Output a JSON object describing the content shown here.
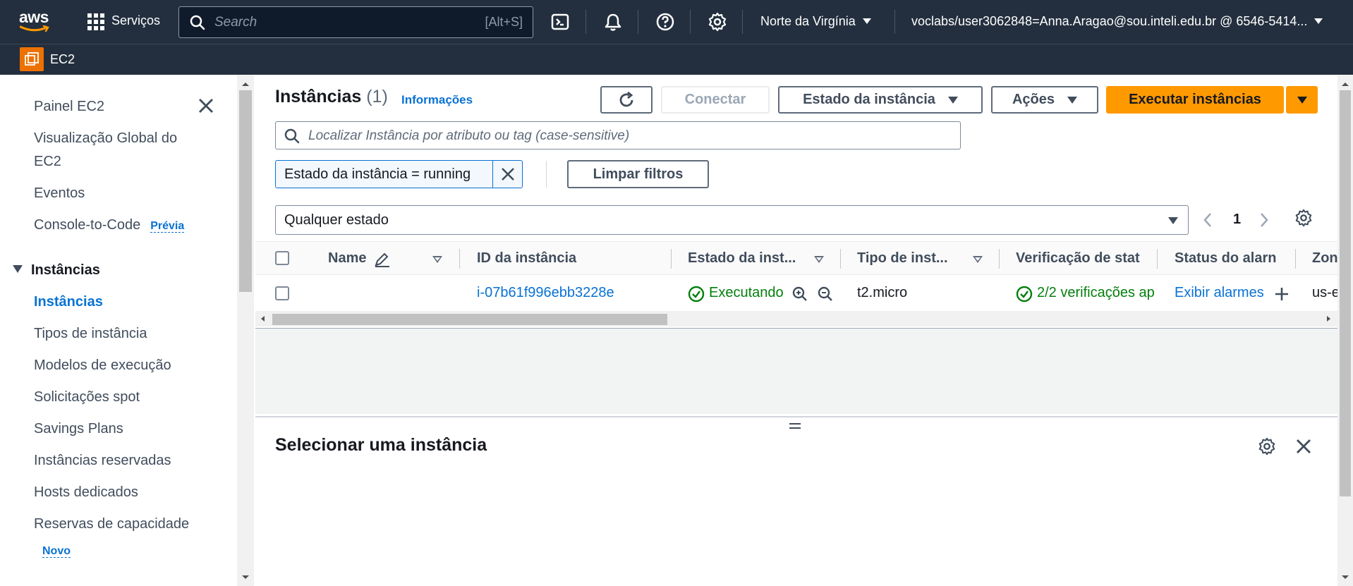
{
  "topnav": {
    "logo_text": "aws",
    "services_label": "Serviços",
    "search_placeholder": "Search",
    "search_shortcut": "[Alt+S]",
    "region": "Norte da Virgínia",
    "account": "voclabs/user3062848=Anna.Aragao@sou.inteli.edu.br @ 6546-5414..."
  },
  "subnav": {
    "service_name": "EC2"
  },
  "sidebar": {
    "items": [
      {
        "label": "Painel EC2"
      },
      {
        "label": "Visualização Global do"
      },
      {
        "label": "EC2"
      },
      {
        "label": "Eventos"
      },
      {
        "label": "Console-to-Code",
        "badge": "Prévia"
      }
    ],
    "section_title": "Instâncias",
    "section_items": [
      {
        "label": "Instâncias"
      },
      {
        "label": "Tipos de instância"
      },
      {
        "label": "Modelos de execução"
      },
      {
        "label": "Solicitações spot"
      },
      {
        "label": "Savings Plans"
      },
      {
        "label": "Instâncias reservadas"
      },
      {
        "label": "Hosts dedicados"
      },
      {
        "label": "Reservas de capacidade",
        "badge": "Novo"
      }
    ]
  },
  "main": {
    "title": "Instâncias",
    "count": "(1)",
    "info_link": "Informações",
    "buttons": {
      "connect": "Conectar",
      "instance_state": "Estado da instância",
      "actions": "Ações",
      "launch": "Executar instâncias",
      "clear_filters": "Limpar filtros"
    },
    "filter_placeholder": "Localizar Instância por atributo ou tag (case-sensitive)",
    "filter_token": "Estado da instância = running",
    "state_select": "Qualquer estado",
    "page_number": "1",
    "columns": [
      "Name",
      "ID da instância",
      "Estado da inst...",
      "Tipo de inst...",
      "Verificação de stat",
      "Status do alarn",
      "Zon"
    ],
    "rows": [
      {
        "name": "",
        "id": "i-07b61f996ebb3228e",
        "state": "Executando",
        "type": "t2.micro",
        "checks": "2/2 verificações ap",
        "alarm": "Exibir alarmes",
        "zone": "us-e"
      }
    ],
    "details_title": "Selecionar uma instância"
  },
  "colors": {
    "nav_bg": "#232f3e",
    "link": "#0972d3",
    "primary": "#ff9900",
    "success": "#037f0c",
    "ec2_badge": "#ed7100"
  }
}
